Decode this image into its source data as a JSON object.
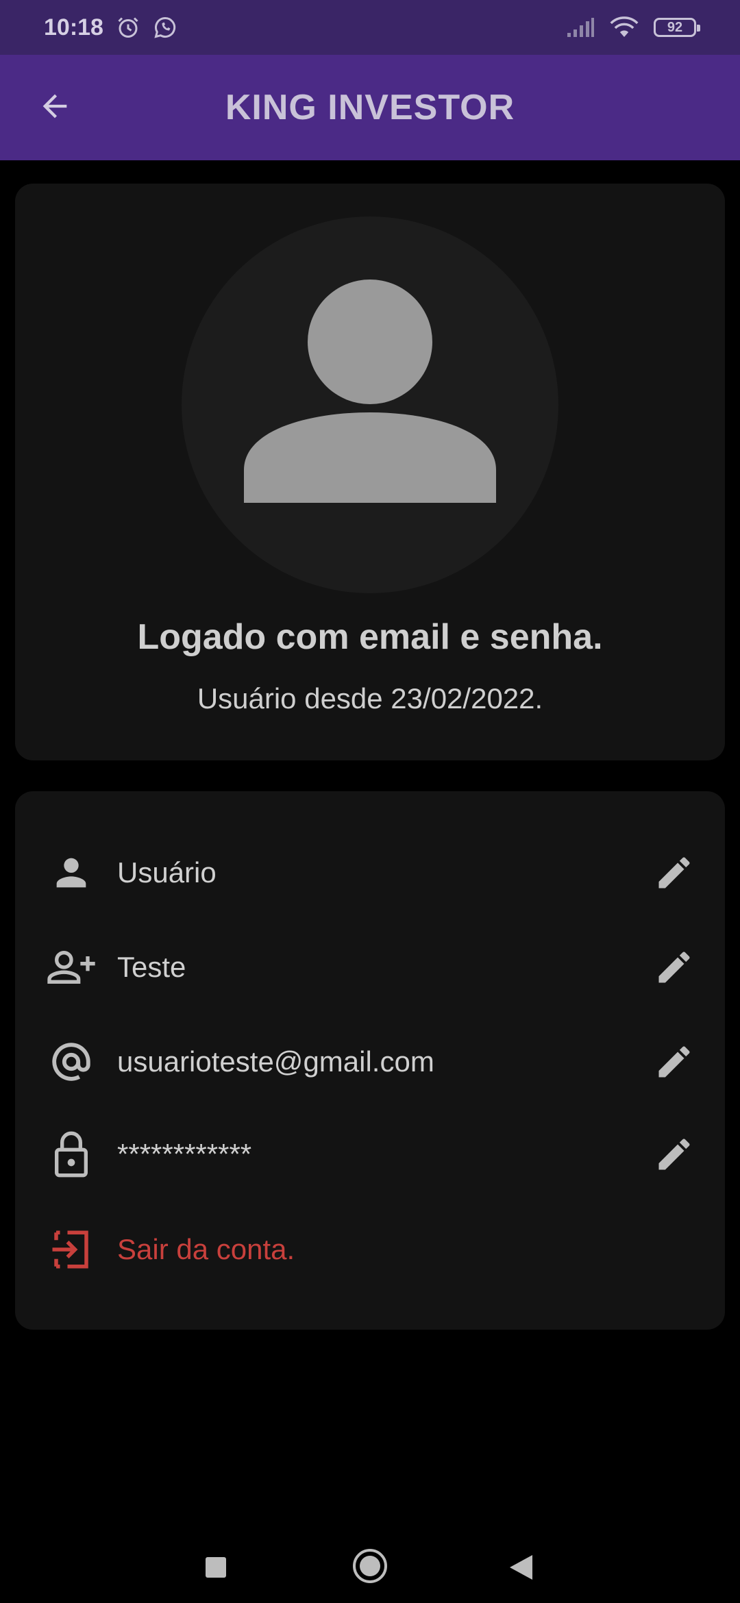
{
  "status_bar": {
    "time": "10:18",
    "battery": "92",
    "icons": [
      "alarm-icon",
      "whatsapp-icon",
      "signal-icon",
      "wifi-icon",
      "battery-icon"
    ]
  },
  "app_bar": {
    "title": "KING INVESTOR",
    "back_icon": "arrow-back-icon",
    "background_color": "#4b2a86"
  },
  "profile": {
    "avatar_icon": "person-icon",
    "login_method": "Logado com email e senha.",
    "member_since": "Usuário desde 23/02/2022."
  },
  "fields": [
    {
      "icon": "person-icon",
      "value": "Usuário",
      "edit_icon": "pencil-icon"
    },
    {
      "icon": "person-add-icon",
      "value": "Teste",
      "edit_icon": "pencil-icon"
    },
    {
      "icon": "at-sign-icon",
      "value": "usuarioteste@gmail.com",
      "edit_icon": "pencil-icon"
    },
    {
      "icon": "lock-icon",
      "value": "************",
      "edit_icon": "pencil-icon"
    }
  ],
  "logout": {
    "icon": "logout-icon",
    "label": "Sair da conta.",
    "color": "#c8403c"
  },
  "nav_bar": {
    "icons": [
      "recents-square-icon",
      "home-circle-icon",
      "back-triangle-icon"
    ]
  }
}
